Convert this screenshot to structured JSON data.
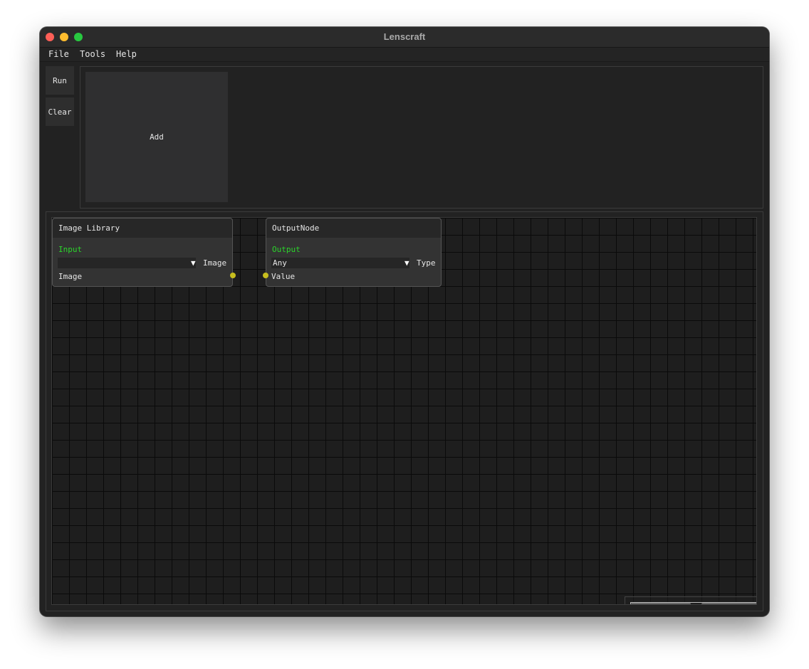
{
  "window": {
    "title": "Lenscraft"
  },
  "menu": {
    "items": [
      "File",
      "Tools",
      "Help"
    ]
  },
  "toolbar": {
    "run_label": "Run",
    "clear_label": "Clear"
  },
  "top_panel": {
    "add_label": "Add"
  },
  "nodes": [
    {
      "title": "Image Library",
      "section": "Input",
      "combo_value": "",
      "combo_label": "Image",
      "pin_label": "Image",
      "pin_side": "output"
    },
    {
      "title": "OutputNode",
      "section": "Output",
      "combo_value": "Any",
      "combo_label": "Type",
      "pin_label": "Value",
      "pin_side": "input"
    }
  ],
  "colors": {
    "section_text": "#2bd52b",
    "pin": "#c7be1e",
    "background": "#222222",
    "canvas": "#1e1e1e"
  },
  "icons": {
    "close": "close-traffic-light",
    "minimize": "minimize-traffic-light",
    "zoom": "zoom-traffic-light",
    "combo_arrow": "triangle-down-icon"
  }
}
